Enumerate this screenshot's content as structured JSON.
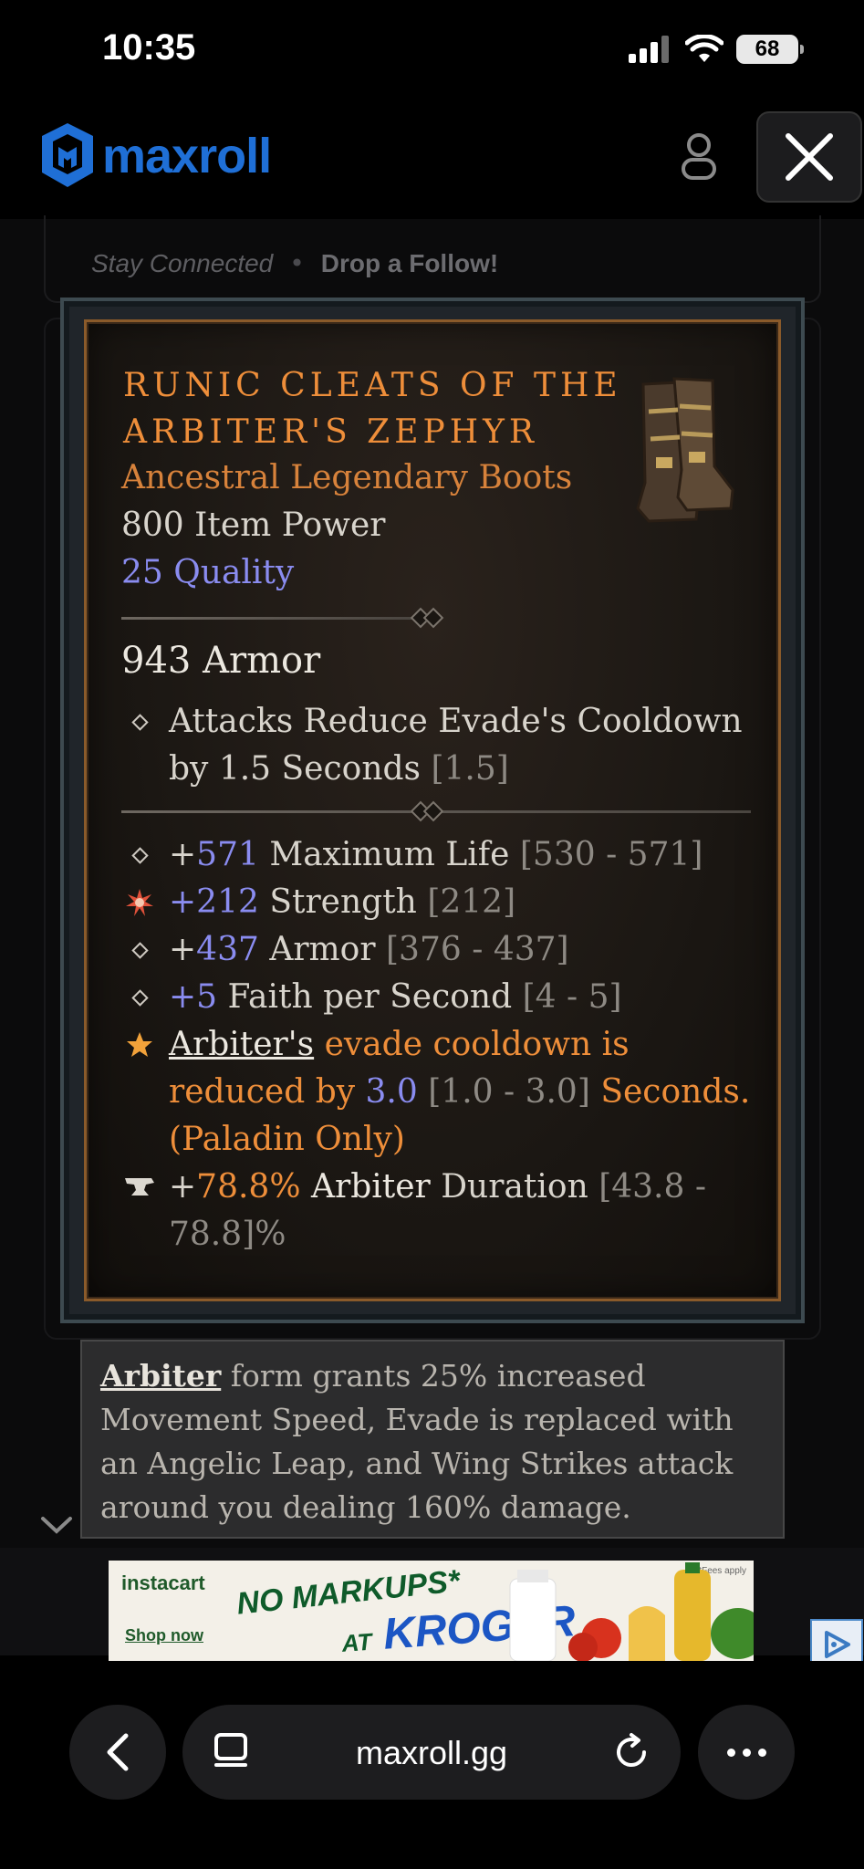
{
  "status_bar": {
    "time": "10:35",
    "battery": "68"
  },
  "header": {
    "logo_text": "maxroll"
  },
  "connect": {
    "label": "Stay Connected",
    "separator": "•",
    "follow": "Drop a Follow!"
  },
  "item": {
    "name": "RUNIC CLEATS OF THE ARBITER'S ZEPHYR",
    "type": "Ancestral Legendary Boots",
    "power": "800 Item Power",
    "quality": "25 Quality",
    "armor": "943 Armor",
    "implicit": {
      "text": "Attacks Reduce Evade's Cooldown by 1.5 Seconds",
      "range": "[1.5]"
    },
    "affixes": [
      {
        "plus": "+",
        "value": "571",
        "stat": " Maximum Life ",
        "range": "[530 - 571]",
        "icon": "diamond-bullet-icon"
      },
      {
        "plus": "",
        "value": "+212",
        "stat": " Strength ",
        "range": "[212]",
        "icon": "greater-affix-icon"
      },
      {
        "plus": "+",
        "value": "437",
        "stat": " Armor ",
        "range": "[376 - 437]",
        "icon": "diamond-bullet-icon"
      },
      {
        "plus": "",
        "value": "+5",
        "stat": " Faith per Second ",
        "range": "[4 - 5]",
        "icon": "diamond-bullet-icon"
      }
    ],
    "legendary": {
      "keyword": "Arbiter's",
      "text1": " evade cooldown is reduced by ",
      "value": "3.0",
      "range": " [1.0 - 3.0] ",
      "text2": "Seconds. (Paladin Only)"
    },
    "tempered": {
      "plus": "+",
      "value": "78.8%",
      "stat1": " Arbiter",
      "stat2": " Duration ",
      "range": "[43.8 - 78.8]%"
    }
  },
  "tooltip": {
    "keyword": "Arbiter",
    "text": " form grants 25% increased Movement Speed, Evade is replaced with an Angelic Leap, and Wing Strikes attack around you dealing 160% damage."
  },
  "ad": {
    "brand": "instacart",
    "headline1": "NO MARKUPS*",
    "headline2_prefix": "AT",
    "headline2": "KROGER",
    "cta": "Shop now",
    "fine_print": "*Fees apply"
  },
  "browser": {
    "url": "maxroll.gg"
  },
  "colors": {
    "accent": "#1f6fd6",
    "legendary": "#ee8e3a",
    "quality": "#8a8cf0"
  }
}
